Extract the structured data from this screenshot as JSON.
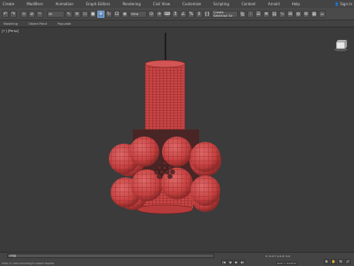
{
  "menubar": {
    "items": [
      "Create",
      "Modifiers",
      "Animation",
      "Graph Editors",
      "Rendering",
      "Civil View",
      "Customize",
      "Scripting",
      "Content",
      "Arnold",
      "Help"
    ],
    "signin_label": "Sign In"
  },
  "toolbar": {
    "undo_icon": "↶",
    "redo_icon": "↷",
    "select_mode": "All",
    "view_mode": "View",
    "selection_set": "Create Selection Se"
  },
  "ribbon": {
    "tabs": [
      "Modeling",
      "Object Paint",
      "Populate"
    ]
  },
  "viewport": {
    "label": "[+] [Persp]"
  },
  "status": {
    "timeline_frame": "0 / 100",
    "coords": "X: 0.0  Y: 0.0  Z: 0.0",
    "message": "Click or click-and-drag to select objects",
    "grid": "Grid = 10.0cm"
  },
  "animation": {
    "buttons": [
      "|◀",
      "◀",
      "▶",
      "▶|"
    ]
  },
  "navigation": {
    "buttons": [
      "⊕",
      "✋",
      "⟲",
      "⤢"
    ]
  },
  "colors": {
    "model_fill": "#c94545",
    "wire": "#6e1a1a",
    "accent": "#5c86b8"
  }
}
